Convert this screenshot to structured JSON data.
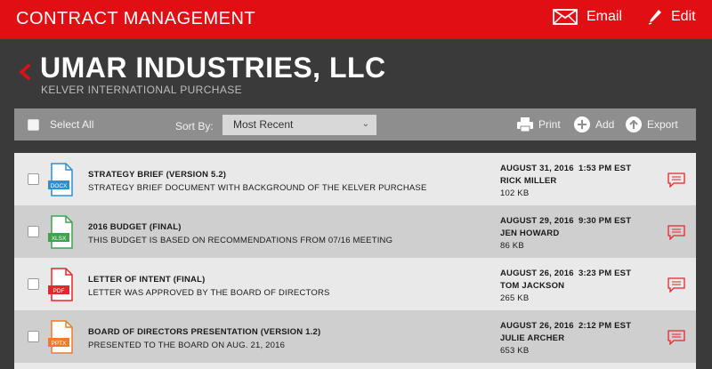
{
  "app": {
    "title": "CONTRACT MANAGEMENT",
    "brand_color": "#e10f14"
  },
  "topbar": {
    "email_label": "Email",
    "edit_label": "Edit"
  },
  "header": {
    "company": "UMAR INDUSTRIES, LLC",
    "subtitle": "KELVER INTERNATIONAL PURCHASE"
  },
  "toolbar": {
    "select_all_label": "Select All",
    "sort_label": "Sort By:",
    "sort_selected": "Most Recent",
    "print_label": "Print",
    "add_label": "Add",
    "export_label": "Export"
  },
  "documents": [
    {
      "title": "STRATEGY BRIEF (VERSION 5.2)",
      "description": "STRATEGY BRIEF DOCUMENT WITH BACKGROUND OF THE KELVER PURCHASE",
      "date": "AUGUST 31, 2016",
      "time": "1:53 PM EST",
      "owner": "RICK MILLER",
      "size": "102 KB",
      "file_type": "DOCX",
      "type_color": "#2b8fd6",
      "row_bg": "#e9e9e9"
    },
    {
      "title": "2016 BUDGET  (FINAL)",
      "description": "THIS BUDGET IS BASED ON RECOMMENDATIONS FROM 07/16 MEETING",
      "date": "AUGUST 29, 2016",
      "time": "9:30 PM EST",
      "owner": "JEN HOWARD",
      "size": "86 KB",
      "file_type": "XLSX",
      "type_color": "#3fa34d",
      "row_bg": "#cfcfcf"
    },
    {
      "title": "LETTER OF INTENT (FINAL)",
      "description": "LETTER WAS APPROVED BY THE BOARD OF DIRECTORS",
      "date": "AUGUST 26, 2016",
      "time": "3:23 PM EST",
      "owner": "TOM JACKSON",
      "size": "265 KB",
      "file_type": "PDF",
      "type_color": "#e5262b",
      "row_bg": "#e9e9e9"
    },
    {
      "title": "BOARD OF DIRECTORS PRESENTATION (VERSION 1.2)",
      "description": "PRESENTED TO THE BOARD ON AUG. 21, 2016",
      "date": "AUGUST 26, 2016",
      "time": "2:12 PM EST",
      "owner": "JULIE ARCHER",
      "size": "653 KB",
      "file_type": "PPTX",
      "type_color": "#f07a2d",
      "row_bg": "#cfcfcf"
    }
  ]
}
